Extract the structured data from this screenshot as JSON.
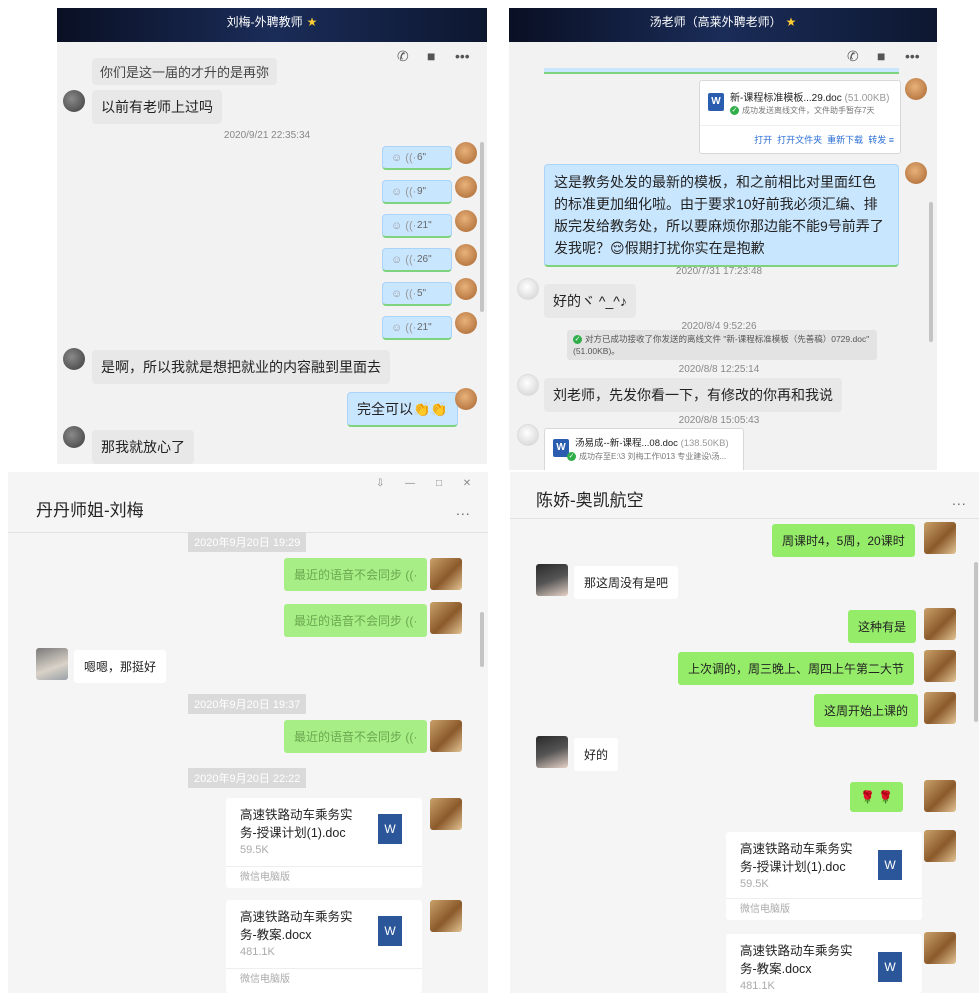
{
  "p1": {
    "title": "刘梅-外聘教师",
    "partial_top": "你们是这一届的才升的是再弥",
    "msg1": "以前有老师上过吗",
    "ts1": "2020/9/21 22:35:34",
    "voices": [
      "6\"",
      "9\"",
      "21\"",
      "26\"",
      "5\"",
      "21\""
    ],
    "msg2": "是啊，所以我就是想把就业的内容融到里面去",
    "msg3": "完全可以👏👏",
    "msg4": "那我就放心了"
  },
  "p2": {
    "title": "汤老师（高莱外聘老师）",
    "file1_name": "新-课程标准模板...29.doc",
    "file1_size": "(51.00KB)",
    "file1_status": "成功发送离线文件，文件助手暂存7天",
    "file1_actions": [
      "打开",
      "打开文件夹",
      "重新下载",
      "转发"
    ],
    "msg_long": "这是教务处发的最新的模板，和之前相比对里面红色的标准更加细化啦。由于要求10好前我必须汇编、排版完发给教务处，所以要麻烦你那边能不能9号前弄了发我呢？😌假期打扰你实在是抱歉",
    "ts1": "2020/7/31 17:23:48",
    "msg2": "好的ヾ ^_^♪",
    "ts2": "2020/8/4 9:52:26",
    "sys_notice": "对方已成功接收了你发送的离线文件 \"新-课程标准模板（先善稿）0729.doc\" (51.00KB)。",
    "ts3": "2020/8/8 12:25:14",
    "msg3": "刘老师，先发你看一下，有修改的你再和我说",
    "ts4": "2020/8/8 15:05:43",
    "file2_name": "汤易成--新-课程...08.doc",
    "file2_size": "(138.50KB)",
    "file2_status": "成功存至E:\\3 刘梅工作\\013 专业建设\\汤..."
  },
  "p3": {
    "title": "丹丹师姐-刘梅",
    "more": "...",
    "ts1": "2020年9月20日 19:29",
    "voice_text": "最近的语音不会同步",
    "msg_in": "嗯嗯，那挺好",
    "ts2": "2020年9月20日 19:37",
    "ts3": "2020年9月20日 22:22",
    "file1_name": "高速铁路动车乘务实务-授课计划(1).doc",
    "file1_size": "59.5K",
    "file2_name": "高速铁路动车乘务实务-教案.docx",
    "file2_size": "481.1K",
    "file_footer": "微信电脑版",
    "doc_letter": "W",
    "win_controls": [
      "⇩",
      "—",
      "□",
      "✕"
    ]
  },
  "p4": {
    "title": "陈娇-奥凯航空",
    "more": "...",
    "m1": "周课时4，5周，20课时",
    "m2": "那这周没有是吧",
    "m3": "这种有是",
    "m4": "上次调的，周三晚上、周四上午第二大节",
    "m5": "这周开始上课的",
    "m6": "好的",
    "m7": "🌹 🌹",
    "file1_name": "高速铁路动车乘务实务-授课计划(1).doc",
    "file1_size": "59.5K",
    "file2_name": "高速铁路动车乘务实务-教案.docx",
    "file2_size": "481.1K",
    "file_footer": "微信电脑版",
    "doc_letter": "W"
  },
  "icons": {
    "phone": "phone-icon",
    "video": "video-icon",
    "more": "more-icon"
  }
}
